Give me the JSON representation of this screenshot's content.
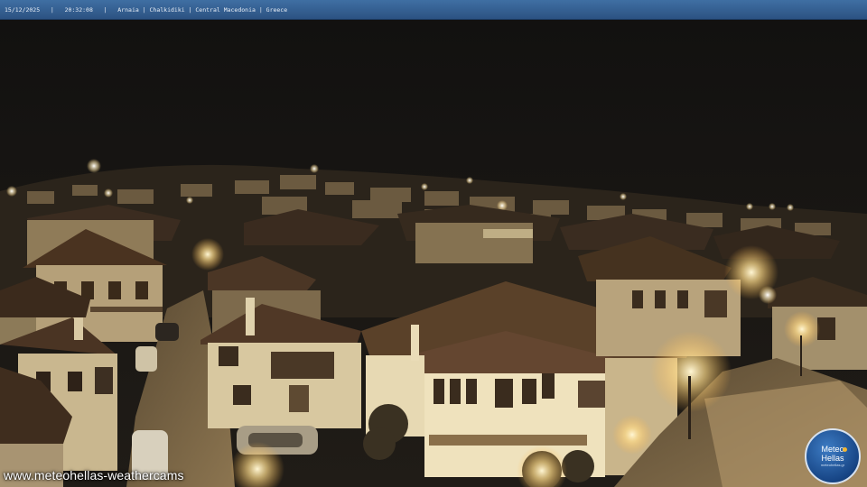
{
  "header": {
    "date": "15/12/2025",
    "time": "20:32:08",
    "separator": "|",
    "location": "Arnaia | Chalkidiki | Central Macedonia | Greece"
  },
  "watermark": {
    "text": "www.meteohellas-weathercams"
  },
  "logo": {
    "line1": "Meteo",
    "line2": "Hellas",
    "line3": "meteohellas.gr"
  },
  "scene": {
    "description_icon": "night-town-icon",
    "sky_color": "#161412",
    "light_color": "#ffe7a6"
  }
}
